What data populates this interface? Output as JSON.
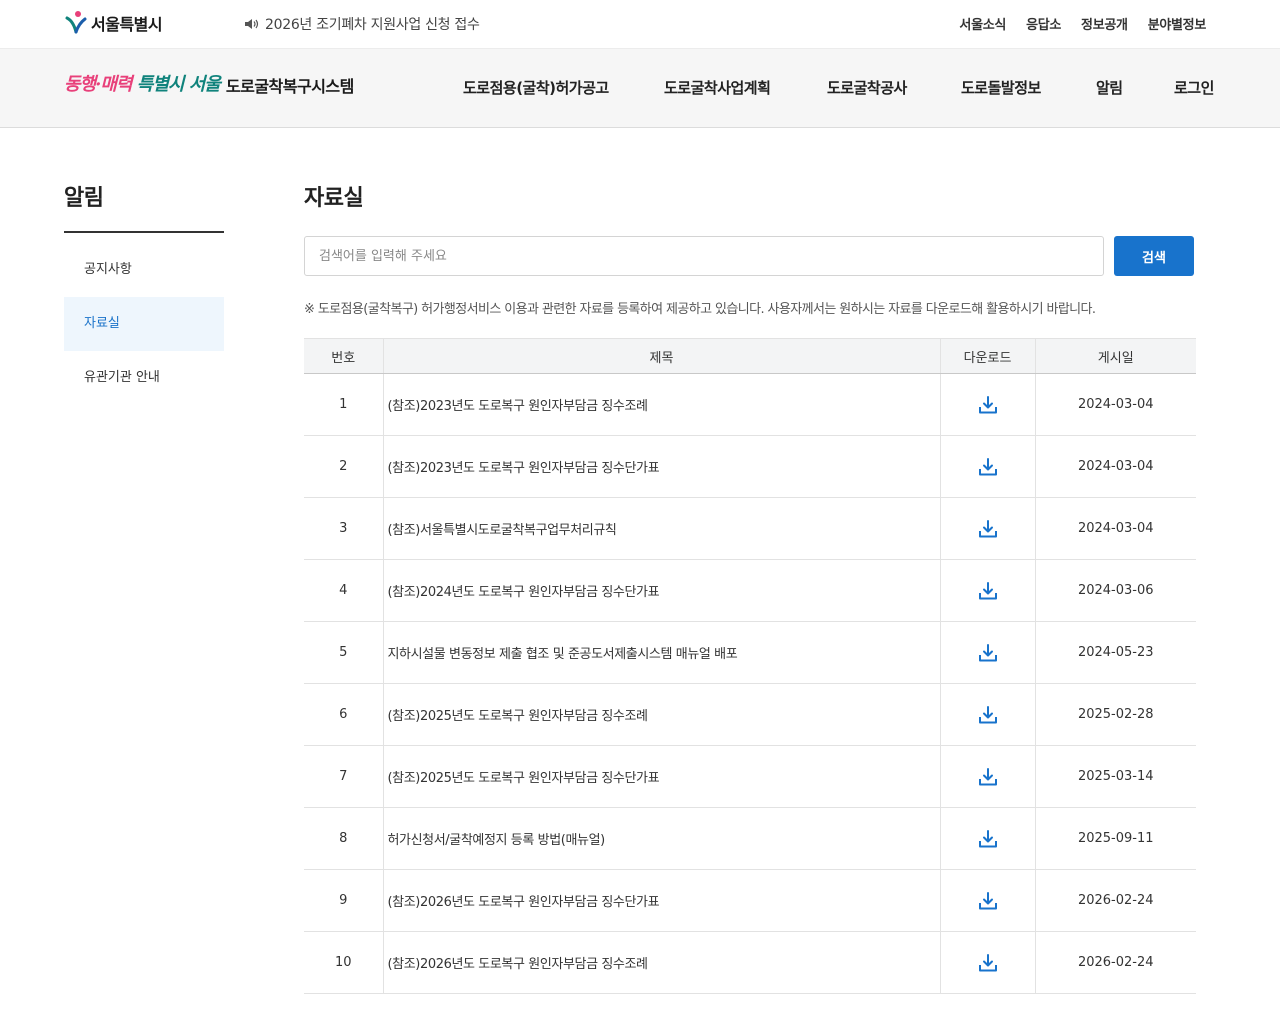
{
  "top": {
    "logo_text": "서울특별시",
    "notice": "2026년 조기폐차 지원사업 신청 접수",
    "links": [
      "서울소식",
      "응답소",
      "정보공개",
      "분야별정보"
    ]
  },
  "brand": {
    "slogan_part1": "동행·매력",
    "slogan_part2": "특별시 서울",
    "title": "도로굴착복구시스템"
  },
  "gnb": [
    "도로점용(굴착)허가공고",
    "도로굴착사업계획",
    "도로굴착공사",
    "도로돌발정보",
    "알림",
    "로그인"
  ],
  "lnb": {
    "title": "알림",
    "items": [
      "공지사항",
      "자료실",
      "유관기관 안내"
    ],
    "active_index": 1
  },
  "content": {
    "title": "자료실",
    "search_placeholder": "검색어를 입력해 주세요",
    "search_button": "검색",
    "guide": "※ 도로점용(굴착복구) 허가행정서비스 이용과 관련한 자료를 등록하여 제공하고 있습니다. 사용자께서는 원하시는 자료를 다운로드해 활용하시기 바랍니다."
  },
  "table": {
    "headers": [
      "번호",
      "제목",
      "다운로드",
      "게시일"
    ],
    "rows": [
      {
        "no": "1",
        "title": "(참조)2023년도 도로복구 원인자부담금 징수조례",
        "date": "2024-03-04"
      },
      {
        "no": "2",
        "title": "(참조)2023년도 도로복구 원인자부담금 징수단가표",
        "date": "2024-03-04"
      },
      {
        "no": "3",
        "title": "(참조)서울특별시도로굴착복구업무처리규칙",
        "date": "2024-03-04"
      },
      {
        "no": "4",
        "title": "(참조)2024년도 도로복구 원인자부담금 징수단가표",
        "date": "2024-03-06"
      },
      {
        "no": "5",
        "title": "지하시설물 변동정보 제출 협조 및 준공도서제출시스템 매뉴얼 배포",
        "date": "2024-05-23"
      },
      {
        "no": "6",
        "title": "(참조)2025년도 도로복구 원인자부담금 징수조례",
        "date": "2025-02-28"
      },
      {
        "no": "7",
        "title": "(참조)2025년도 도로복구 원인자부담금 징수단가표",
        "date": "2025-03-14"
      },
      {
        "no": "8",
        "title": "허가신청서/굴착예정지 등록 방법(매뉴얼)",
        "date": "2025-09-11"
      },
      {
        "no": "9",
        "title": "(참조)2026년도 도로복구 원인자부담금 징수단가표",
        "date": "2026-02-24"
      },
      {
        "no": "10",
        "title": "(참조)2026년도 도로복구 원인자부담금 징수조례",
        "date": "2026-02-24"
      }
    ]
  },
  "colors": {
    "accent": "#1873cc",
    "active_bg": "#eef6fd",
    "slogan_pink": "#e8407a",
    "slogan_teal": "#10837c"
  }
}
